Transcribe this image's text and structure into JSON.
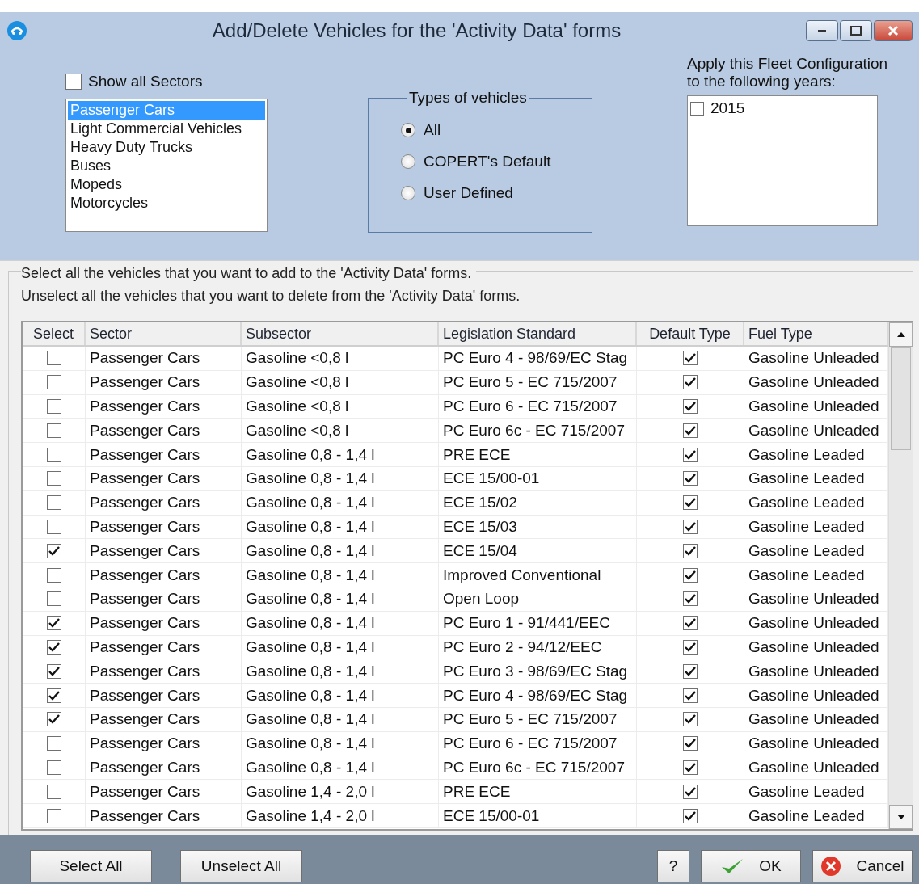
{
  "window": {
    "title": "Add/Delete Vehicles for the 'Activity Data' forms"
  },
  "show_all_sectors": {
    "label": "Show all Sectors",
    "checked": false
  },
  "sectors": [
    {
      "label": "Passenger Cars",
      "selected": true
    },
    {
      "label": "Light Commercial Vehicles",
      "selected": false
    },
    {
      "label": "Heavy Duty Trucks",
      "selected": false
    },
    {
      "label": "Buses",
      "selected": false
    },
    {
      "label": "Mopeds",
      "selected": false
    },
    {
      "label": "Motorcycles",
      "selected": false
    }
  ],
  "vehicle_types": {
    "title": "Types of vehicles",
    "options": [
      {
        "label": "All",
        "selected": true
      },
      {
        "label": "COPERT's Default",
        "selected": false
      },
      {
        "label": "User Defined",
        "selected": false
      }
    ]
  },
  "years": {
    "label": "Apply this Fleet Configuration to the following years:",
    "items": [
      {
        "label": "2015",
        "checked": false
      }
    ]
  },
  "instructions": {
    "line_1": "Select all the vehicles that you want to add to the 'Activity Data' forms.",
    "line_2": "Unselect all the vehicles that you want to delete from the 'Activity Data' forms."
  },
  "table": {
    "columns": [
      "Select",
      "Sector",
      "Subsector",
      "Legislation Standard",
      "Default Type",
      "Fuel Type"
    ],
    "rows": [
      {
        "select": false,
        "sector": "Passenger Cars",
        "subsector": "Gasoline <0,8 l",
        "legislation": "PC Euro 4 - 98/69/EC Stag",
        "default_type": true,
        "fuel": "Gasoline Unleaded"
      },
      {
        "select": false,
        "sector": "Passenger Cars",
        "subsector": "Gasoline <0,8 l",
        "legislation": "PC Euro 5 - EC 715/2007",
        "default_type": true,
        "fuel": "Gasoline Unleaded"
      },
      {
        "select": false,
        "sector": "Passenger Cars",
        "subsector": "Gasoline <0,8 l",
        "legislation": "PC Euro 6 - EC 715/2007",
        "default_type": true,
        "fuel": "Gasoline Unleaded"
      },
      {
        "select": false,
        "sector": "Passenger Cars",
        "subsector": "Gasoline <0,8 l",
        "legislation": "PC Euro 6c - EC 715/2007",
        "default_type": true,
        "fuel": "Gasoline Unleaded"
      },
      {
        "select": false,
        "sector": "Passenger Cars",
        "subsector": "Gasoline 0,8 - 1,4 l",
        "legislation": "PRE ECE",
        "default_type": true,
        "fuel": "Gasoline Leaded"
      },
      {
        "select": false,
        "sector": "Passenger Cars",
        "subsector": "Gasoline 0,8 - 1,4 l",
        "legislation": "ECE 15/00-01",
        "default_type": true,
        "fuel": "Gasoline Leaded"
      },
      {
        "select": false,
        "sector": "Passenger Cars",
        "subsector": "Gasoline 0,8 - 1,4 l",
        "legislation": "ECE 15/02",
        "default_type": true,
        "fuel": "Gasoline Leaded"
      },
      {
        "select": false,
        "sector": "Passenger Cars",
        "subsector": "Gasoline 0,8 - 1,4 l",
        "legislation": "ECE 15/03",
        "default_type": true,
        "fuel": "Gasoline Leaded"
      },
      {
        "select": true,
        "sector": "Passenger Cars",
        "subsector": "Gasoline 0,8 - 1,4 l",
        "legislation": "ECE 15/04",
        "default_type": true,
        "fuel": "Gasoline Leaded"
      },
      {
        "select": false,
        "sector": "Passenger Cars",
        "subsector": "Gasoline 0,8 - 1,4 l",
        "legislation": "Improved Conventional",
        "default_type": true,
        "fuel": "Gasoline Leaded"
      },
      {
        "select": false,
        "sector": "Passenger Cars",
        "subsector": "Gasoline 0,8 - 1,4 l",
        "legislation": "Open Loop",
        "default_type": true,
        "fuel": "Gasoline Unleaded"
      },
      {
        "select": true,
        "sector": "Passenger Cars",
        "subsector": "Gasoline 0,8 - 1,4 l",
        "legislation": "PC Euro 1 - 91/441/EEC",
        "default_type": true,
        "fuel": "Gasoline Unleaded"
      },
      {
        "select": true,
        "sector": "Passenger Cars",
        "subsector": "Gasoline 0,8 - 1,4 l",
        "legislation": "PC Euro 2 - 94/12/EEC",
        "default_type": true,
        "fuel": "Gasoline Unleaded"
      },
      {
        "select": true,
        "sector": "Passenger Cars",
        "subsector": "Gasoline 0,8 - 1,4 l",
        "legislation": "PC Euro 3 - 98/69/EC Stag",
        "default_type": true,
        "fuel": "Gasoline Unleaded"
      },
      {
        "select": true,
        "sector": "Passenger Cars",
        "subsector": "Gasoline 0,8 - 1,4 l",
        "legislation": "PC Euro 4 - 98/69/EC Stag",
        "default_type": true,
        "fuel": "Gasoline Unleaded"
      },
      {
        "select": true,
        "sector": "Passenger Cars",
        "subsector": "Gasoline 0,8 - 1,4 l",
        "legislation": "PC Euro 5 - EC 715/2007",
        "default_type": true,
        "fuel": "Gasoline Unleaded"
      },
      {
        "select": false,
        "sector": "Passenger Cars",
        "subsector": "Gasoline 0,8 - 1,4 l",
        "legislation": "PC Euro 6 - EC 715/2007",
        "default_type": true,
        "fuel": "Gasoline Unleaded"
      },
      {
        "select": false,
        "sector": "Passenger Cars",
        "subsector": "Gasoline 0,8 - 1,4 l",
        "legislation": "PC Euro 6c - EC 715/2007",
        "default_type": true,
        "fuel": "Gasoline Unleaded"
      },
      {
        "select": false,
        "sector": "Passenger Cars",
        "subsector": "Gasoline 1,4 - 2,0 l",
        "legislation": "PRE ECE",
        "default_type": true,
        "fuel": "Gasoline Leaded"
      },
      {
        "select": false,
        "sector": "Passenger Cars",
        "subsector": "Gasoline 1,4 - 2,0 l",
        "legislation": "ECE 15/00-01",
        "default_type": true,
        "fuel": "Gasoline Leaded"
      }
    ]
  },
  "buttons": {
    "select_all": "Select All",
    "unselect_all": "Unselect All",
    "help": "?",
    "ok": "OK",
    "cancel": "Cancel"
  }
}
